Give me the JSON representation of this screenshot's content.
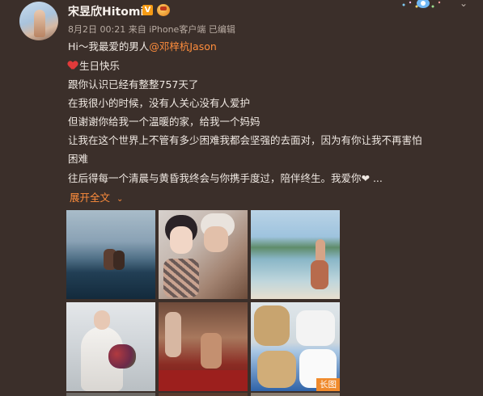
{
  "user": {
    "name": "宋昱欣Hitomi",
    "verified_badge": "V",
    "vip_badge_icon": "vip-badge-icon"
  },
  "meta": {
    "time": "8月2日 00:21",
    "source": "来自 iPhone客户端",
    "edited": "已编辑"
  },
  "post": {
    "line1_prefix": "Hi～我最爱的男人",
    "line1_mention": "@邓梓杭Jason",
    "line2": "生日快乐",
    "line3": "跟你认识已经有整整757天了",
    "line4": "在我很小的时候，没有人关心没有人爱护",
    "line5": "但谢谢你给我一个温暖的家，给我一个妈妈",
    "line6": "让我在这个世界上不管有多少困难我都会坚强的去面对，因为有你让我不再害怕",
    "line7": "困难",
    "line8": "往后得每一个清晨与黄昏我终会与你携手度过，陪伴终生。我爱你❤ ...",
    "expand_label": "展开全文",
    "long_image_label": "长图"
  },
  "colors": {
    "background": "#3b2f2a",
    "accent": "#ff8d3c",
    "verified": "#f59b15"
  }
}
